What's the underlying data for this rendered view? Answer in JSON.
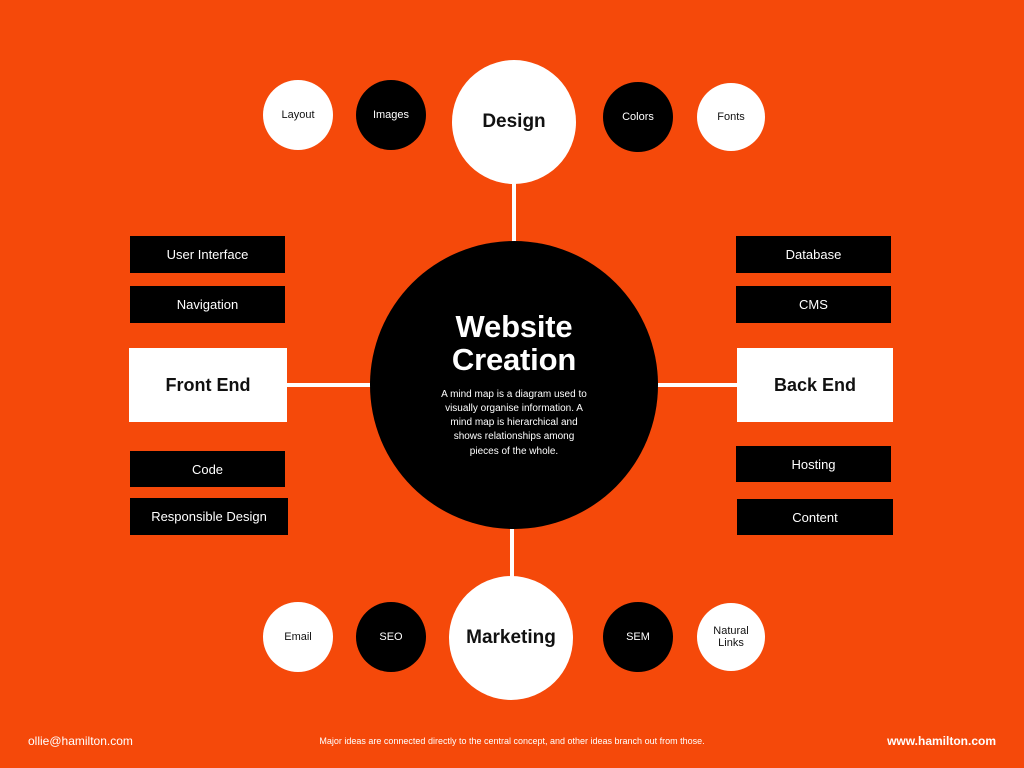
{
  "theme": {
    "background": "#F5490A",
    "dark": "#000000",
    "light": "#FFFFFF",
    "connector": "#FFFFFF"
  },
  "center": {
    "title": "Website\nCreation",
    "description": "A mind map is a diagram used to visually organise information. A mind map is hierarchical and shows relationships among pieces of the whole."
  },
  "branches": {
    "top": {
      "hub": {
        "label": "Design",
        "fill": "white"
      },
      "leaves": [
        {
          "label": "Layout",
          "fill": "white"
        },
        {
          "label": "Images",
          "fill": "black"
        },
        {
          "label": "Colors",
          "fill": "black"
        },
        {
          "label": "Fonts",
          "fill": "white"
        }
      ]
    },
    "bottom": {
      "hub": {
        "label": "Marketing",
        "fill": "white"
      },
      "leaves": [
        {
          "label": "Email",
          "fill": "white"
        },
        {
          "label": "SEO",
          "fill": "black"
        },
        {
          "label": "SEM",
          "fill": "black"
        },
        {
          "label": "Natural Links",
          "fill": "white"
        }
      ]
    },
    "left": {
      "hub": {
        "label": "Front End",
        "fill": "white"
      },
      "leaves": [
        {
          "label": "User Interface",
          "fill": "black"
        },
        {
          "label": "Navigation",
          "fill": "black"
        },
        {
          "label": "Code",
          "fill": "black"
        },
        {
          "label": "Responsible Design",
          "fill": "black"
        }
      ]
    },
    "right": {
      "hub": {
        "label": "Back End",
        "fill": "white"
      },
      "leaves": [
        {
          "label": "Database",
          "fill": "black"
        },
        {
          "label": "CMS",
          "fill": "black"
        },
        {
          "label": "Hosting",
          "fill": "black"
        },
        {
          "label": "Content",
          "fill": "black"
        }
      ]
    }
  },
  "footer": {
    "email": "ollie@hamilton.com",
    "note": "Major ideas are connected directly to the central concept, and other ideas branch out from those.",
    "website": "www.hamilton.com"
  }
}
